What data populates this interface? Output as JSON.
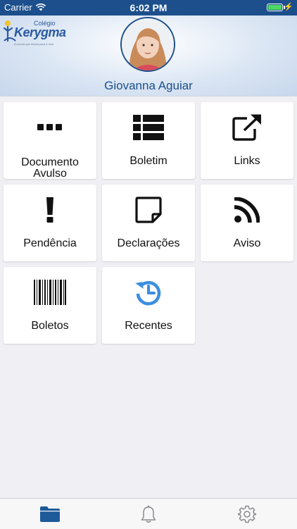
{
  "status_bar": {
    "carrier": "Carrier",
    "time": "6:02 PM"
  },
  "header": {
    "logo": {
      "small": "Colégio",
      "big": "Kerygma",
      "sub": "A escola que educa para a vida"
    },
    "user_name": "Giovanna Aguiar"
  },
  "menu": [
    {
      "label": "Documento Avulso",
      "icon": "ellipsis-icon"
    },
    {
      "label": "Boletim",
      "icon": "list-icon"
    },
    {
      "label": "Links",
      "icon": "external-link-icon"
    },
    {
      "label": "Pendência",
      "icon": "exclamation-icon"
    },
    {
      "label": "Declarações",
      "icon": "note-icon"
    },
    {
      "label": "Aviso",
      "icon": "rss-icon"
    },
    {
      "label": "Boletos",
      "icon": "barcode-icon"
    },
    {
      "label": "Recentes",
      "icon": "history-icon"
    }
  ],
  "tabbar": [
    {
      "name": "tab-documents",
      "icon": "folder-icon",
      "active": true
    },
    {
      "name": "tab-notifications",
      "icon": "bell-icon",
      "active": false
    },
    {
      "name": "tab-settings",
      "icon": "gear-icon",
      "active": false
    }
  ],
  "colors": {
    "accent": "#1c4f8c",
    "recent_icon": "#3b8ee0",
    "tab_active": "#1c5a9a",
    "tab_inactive": "#8a8a8f"
  }
}
